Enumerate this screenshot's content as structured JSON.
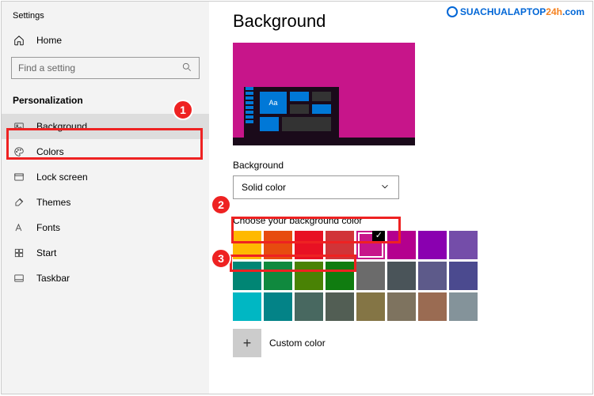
{
  "window": {
    "title": "Settings"
  },
  "sidebar": {
    "home": "Home",
    "search_placeholder": "Find a setting",
    "section": "Personalization",
    "items": [
      {
        "label": "Background",
        "icon": "picture-icon",
        "active": true
      },
      {
        "label": "Colors",
        "icon": "palette-icon"
      },
      {
        "label": "Lock screen",
        "icon": "lockscreen-icon"
      },
      {
        "label": "Themes",
        "icon": "brush-icon"
      },
      {
        "label": "Fonts",
        "icon": "font-icon"
      },
      {
        "label": "Start",
        "icon": "start-icon"
      },
      {
        "label": "Taskbar",
        "icon": "taskbar-icon"
      }
    ]
  },
  "main": {
    "heading": "Background",
    "preview_tile_text": "Aa",
    "bg_label": "Background",
    "bg_value": "Solid color",
    "choose_label": "Choose your background color",
    "custom_label": "Custom color",
    "colors": [
      "#ffb900",
      "#e74b0f",
      "#e81123",
      "#d13438",
      "#c7158a",
      "#b4008e",
      "#8a00b0",
      "#744da9",
      "#018574",
      "#10893e",
      "#498205",
      "#107c10",
      "#6b6b6b",
      "#4a5459",
      "#5d5a8a",
      "#4b4a8f",
      "#00b7c3",
      "#038387",
      "#486860",
      "#525e54",
      "#847545",
      "#7e735f",
      "#9a6b52",
      "#84939a"
    ],
    "selected_color_index": 4
  },
  "annotations": [
    {
      "n": "1",
      "target": "sidebar-background"
    },
    {
      "n": "2",
      "target": "background-dropdown"
    },
    {
      "n": "3",
      "target": "choose-color-label"
    }
  ],
  "watermark": {
    "text_blue": "SUACHUALAPTOP",
    "text_orange": "24h",
    "suffix": ".com"
  }
}
